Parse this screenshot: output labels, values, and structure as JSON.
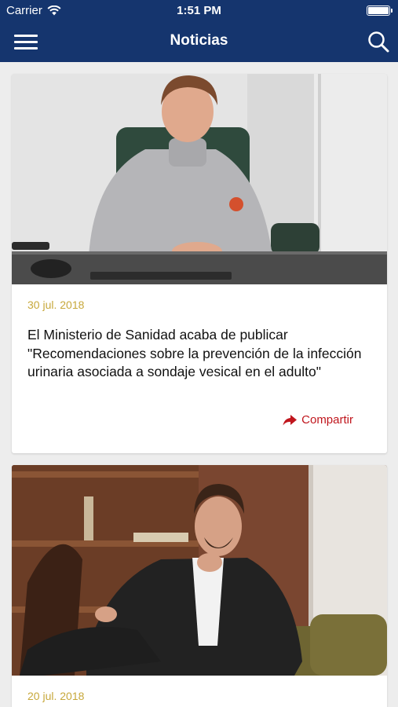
{
  "status_bar": {
    "carrier": "Carrier",
    "time": "1:51 PM"
  },
  "nav": {
    "title": "Noticias",
    "menu_icon": "hamburger-menu-icon",
    "search_icon": "search-icon"
  },
  "colors": {
    "nav_bg": "#15356e",
    "date": "#c7a83b",
    "share": "#c0161d"
  },
  "news": [
    {
      "date": "30 jul. 2018",
      "title": "El Ministerio de Sanidad acaba de publicar \"Recomendaciones sobre la prevención de la infección urinaria asociada a sondaje vesical en el adulto\"",
      "share_label": "Compartir",
      "share_icon": "share-arrow-icon"
    },
    {
      "date": "20 jul. 2018"
    }
  ]
}
